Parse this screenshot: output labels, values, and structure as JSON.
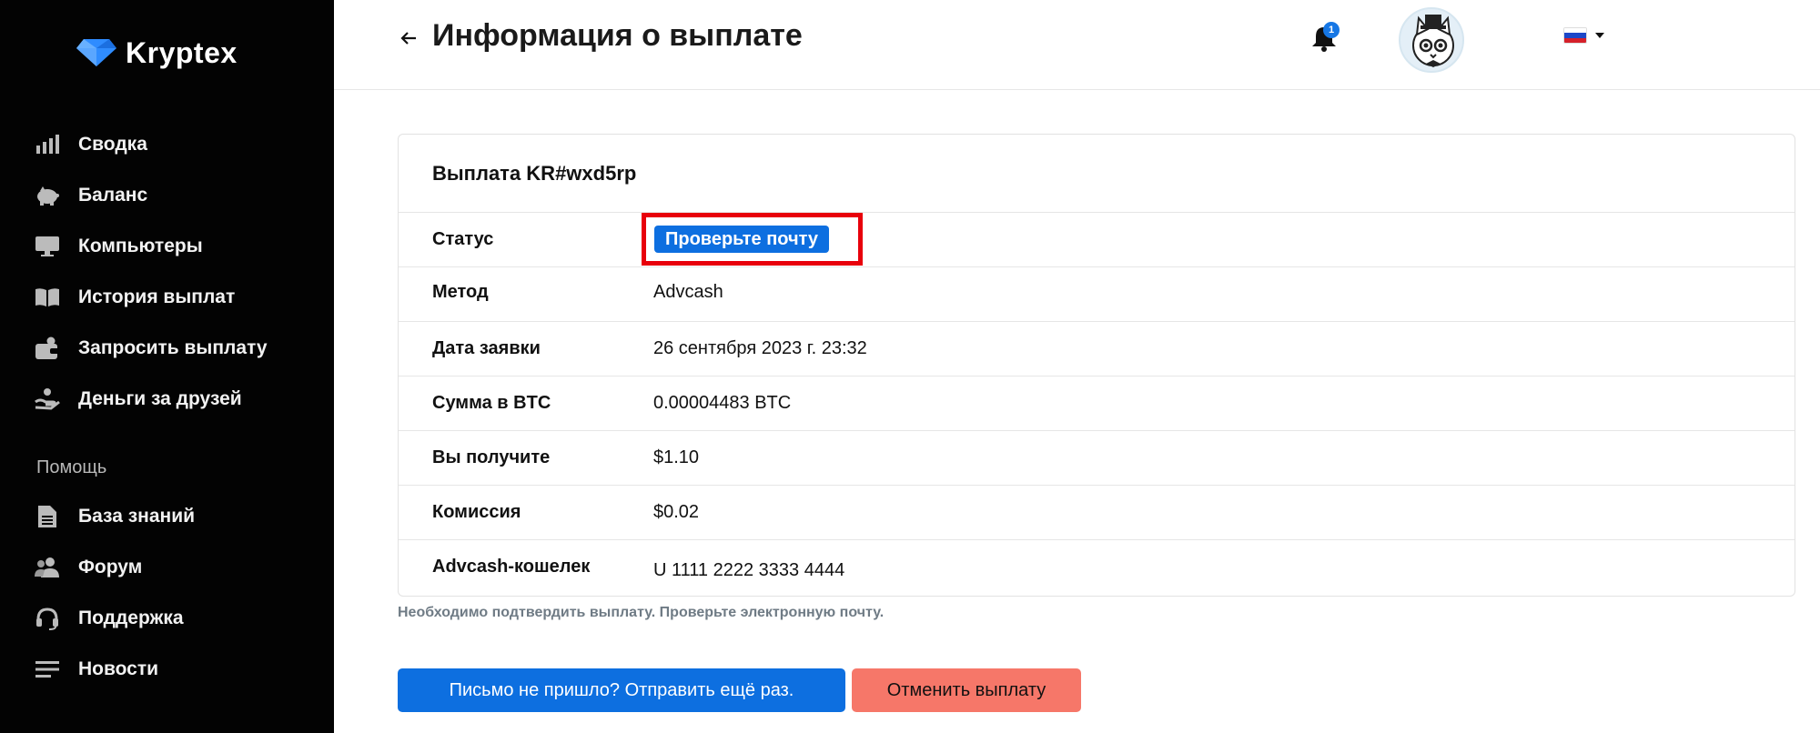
{
  "brand": {
    "name": "Kryptex"
  },
  "sidebar": {
    "items": [
      {
        "label": "Сводка",
        "icon": "bar-chart-icon"
      },
      {
        "label": "Баланс",
        "icon": "piggy-bank-icon"
      },
      {
        "label": "Компьютеры",
        "icon": "monitor-icon"
      },
      {
        "label": "История выплат",
        "icon": "book-icon"
      },
      {
        "label": "Запросить выплату",
        "icon": "wallet-icon"
      },
      {
        "label": "Деньги за друзей",
        "icon": "hand-coin-icon"
      }
    ],
    "help_section": "Помощь",
    "help_items": [
      {
        "label": "База знаний",
        "icon": "document-icon"
      },
      {
        "label": "Форум",
        "icon": "users-icon"
      },
      {
        "label": "Поддержка",
        "icon": "headset-icon"
      },
      {
        "label": "Новости",
        "icon": "lines-icon"
      }
    ]
  },
  "header": {
    "title": "Информация о выплате",
    "notification_count": "1",
    "language": "ru"
  },
  "payout": {
    "title": "Выплата KR#wxd5rp",
    "status_label": "Статус",
    "status_value": "Проверьте почту",
    "rows": [
      {
        "label": "Метод",
        "value": "Advcash"
      },
      {
        "label": "Дата заявки",
        "value": "26 сентября 2023 г. 23:32"
      },
      {
        "label": "Сумма в BTC",
        "value": "0.00004483 BTC"
      },
      {
        "label": "Вы получите",
        "value": "$1.10"
      },
      {
        "label": "Комиссия",
        "value": "$0.02"
      },
      {
        "label": "Advcash-кошелек",
        "value": "U 1111 2222 3333 4444"
      }
    ],
    "note": "Необходимо подтвердить выплату. Проверьте электронную почту."
  },
  "actions": {
    "resend_label": "Письмо не пришло? Отправить ещё раз.",
    "cancel_label": "Отменить выплату"
  },
  "colors": {
    "primary": "#0d6fe0",
    "danger": "#f67769",
    "highlight": "#e8000b",
    "sidebar_bg": "#030303"
  }
}
